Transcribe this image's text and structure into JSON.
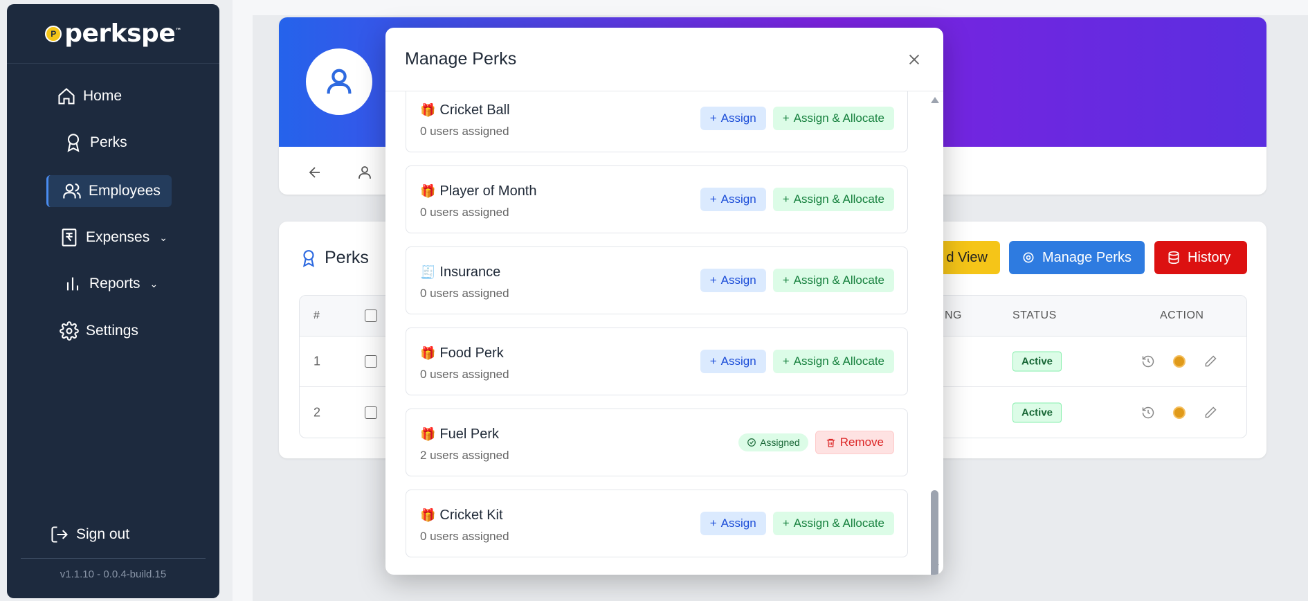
{
  "sidebar": {
    "logo_text": "perkspe",
    "logo_mark": "P",
    "items": [
      {
        "label": "Home",
        "icon": "home-icon"
      },
      {
        "label": "Perks",
        "icon": "award-icon"
      },
      {
        "label": "Employees",
        "icon": "users-icon",
        "active": true
      },
      {
        "label": "Expenses",
        "icon": "receipt-icon",
        "has_chevron": true
      },
      {
        "label": "Reports",
        "icon": "bar-chart-icon",
        "has_chevron": true
      },
      {
        "label": "Settings",
        "icon": "gear-icon"
      }
    ],
    "signout_label": "Sign out",
    "version": "v1.1.10 - 0.0.4-build.15"
  },
  "perks_section": {
    "title": "Perks",
    "card_view_label": "d View",
    "manage_perks_label": "Manage Perks",
    "history_label": "History",
    "table": {
      "headers": {
        "num": "#",
        "rating": "NG",
        "status": "STATUS",
        "action": "ACTION"
      },
      "rows": [
        {
          "num": "1",
          "status": "Active"
        },
        {
          "num": "2",
          "status": "Active"
        }
      ]
    }
  },
  "modal": {
    "title": "Manage Perks",
    "perks": [
      {
        "emoji": "🎁",
        "name": "Cricket Ball",
        "count": "0 users assigned",
        "assigned": false
      },
      {
        "emoji": "🎁",
        "name": "Player of Month",
        "count": "0 users assigned",
        "assigned": false
      },
      {
        "emoji": "🧾",
        "name": "Insurance",
        "count": "0 users assigned",
        "assigned": false
      },
      {
        "emoji": "🎁",
        "name": "Food Perk",
        "count": "0 users assigned",
        "assigned": false
      },
      {
        "emoji": "🎁",
        "name": "Fuel Perk",
        "count": "2 users assigned",
        "assigned": true
      },
      {
        "emoji": "🎁",
        "name": "Cricket Kit",
        "count": "0 users assigned",
        "assigned": false
      }
    ],
    "assign_label": "Assign",
    "allocate_label": "Assign & Allocate",
    "assigned_label": "Assigned",
    "remove_label": "Remove"
  },
  "colors": {
    "sidebar_bg": "#1d2a3e",
    "accent_blue": "#2e7be0",
    "history_red": "#dc1111",
    "card_view_yellow": "#f5c518"
  }
}
